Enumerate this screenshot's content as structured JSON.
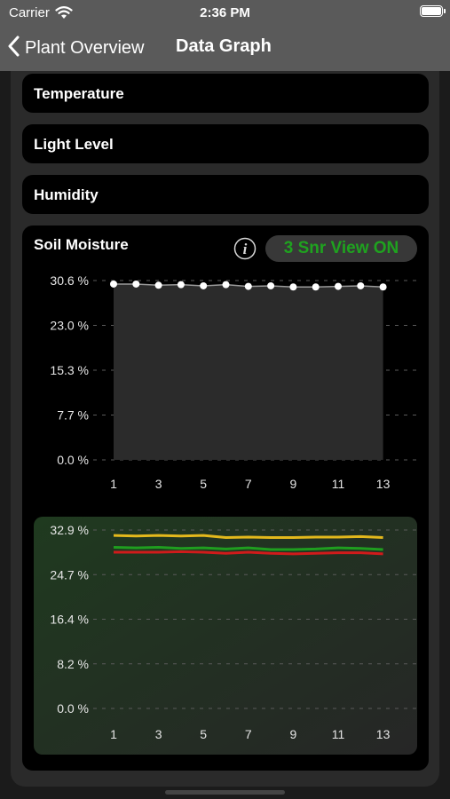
{
  "status_bar": {
    "carrier": "Carrier",
    "time": "2:36 PM"
  },
  "nav": {
    "back_label": "Plant Overview",
    "title": "Data Graph"
  },
  "sections": {
    "temperature": "Temperature",
    "light_level": "Light Level",
    "humidity": "Humidity",
    "soil_moisture": "Soil Moisture"
  },
  "soil": {
    "snr_button": "3 Snr View ON"
  },
  "colors": {
    "accent_green": "#1fa21f",
    "series_yellow": "#e3b81c",
    "series_green": "#1f9e1f",
    "series_red": "#d01b1b"
  },
  "chart_data": [
    {
      "type": "area",
      "x": [
        1,
        2,
        3,
        4,
        5,
        6,
        7,
        8,
        9,
        10,
        11,
        12,
        13
      ],
      "series": [
        {
          "values": [
            30.0,
            30.0,
            29.8,
            29.9,
            29.7,
            29.9,
            29.6,
            29.7,
            29.5,
            29.5,
            29.6,
            29.7,
            29.5
          ]
        }
      ],
      "y_ticks": [
        "0.0 %",
        "7.7 %",
        "15.3 %",
        "23.0 %",
        "30.6 %"
      ],
      "x_ticks": [
        "1",
        "3",
        "5",
        "7",
        "9",
        "11",
        "13"
      ],
      "ylim": [
        0,
        30.6
      ],
      "grid": true
    },
    {
      "type": "line",
      "x": [
        1,
        2,
        3,
        4,
        5,
        6,
        7,
        8,
        9,
        10,
        11,
        12,
        13
      ],
      "series": [
        {
          "color": "#e3b81c",
          "values": [
            31.9,
            31.8,
            31.9,
            31.8,
            31.9,
            31.5,
            31.6,
            31.5,
            31.5,
            31.6,
            31.6,
            31.7,
            31.5
          ]
        },
        {
          "color": "#1f9e1f",
          "values": [
            29.7,
            29.6,
            29.7,
            29.5,
            29.6,
            29.4,
            29.6,
            29.3,
            29.3,
            29.4,
            29.6,
            29.5,
            29.3
          ]
        },
        {
          "color": "#d01b1b",
          "values": [
            28.8,
            28.8,
            28.8,
            28.9,
            28.8,
            28.6,
            28.8,
            28.6,
            28.5,
            28.6,
            28.7,
            28.7,
            28.5
          ]
        }
      ],
      "y_ticks": [
        "0.0 %",
        "8.2 %",
        "16.4 %",
        "24.7 %",
        "32.9 %"
      ],
      "x_ticks": [
        "1",
        "3",
        "5",
        "7",
        "9",
        "11",
        "13"
      ],
      "ylim": [
        0,
        32.9
      ],
      "grid": true
    }
  ]
}
